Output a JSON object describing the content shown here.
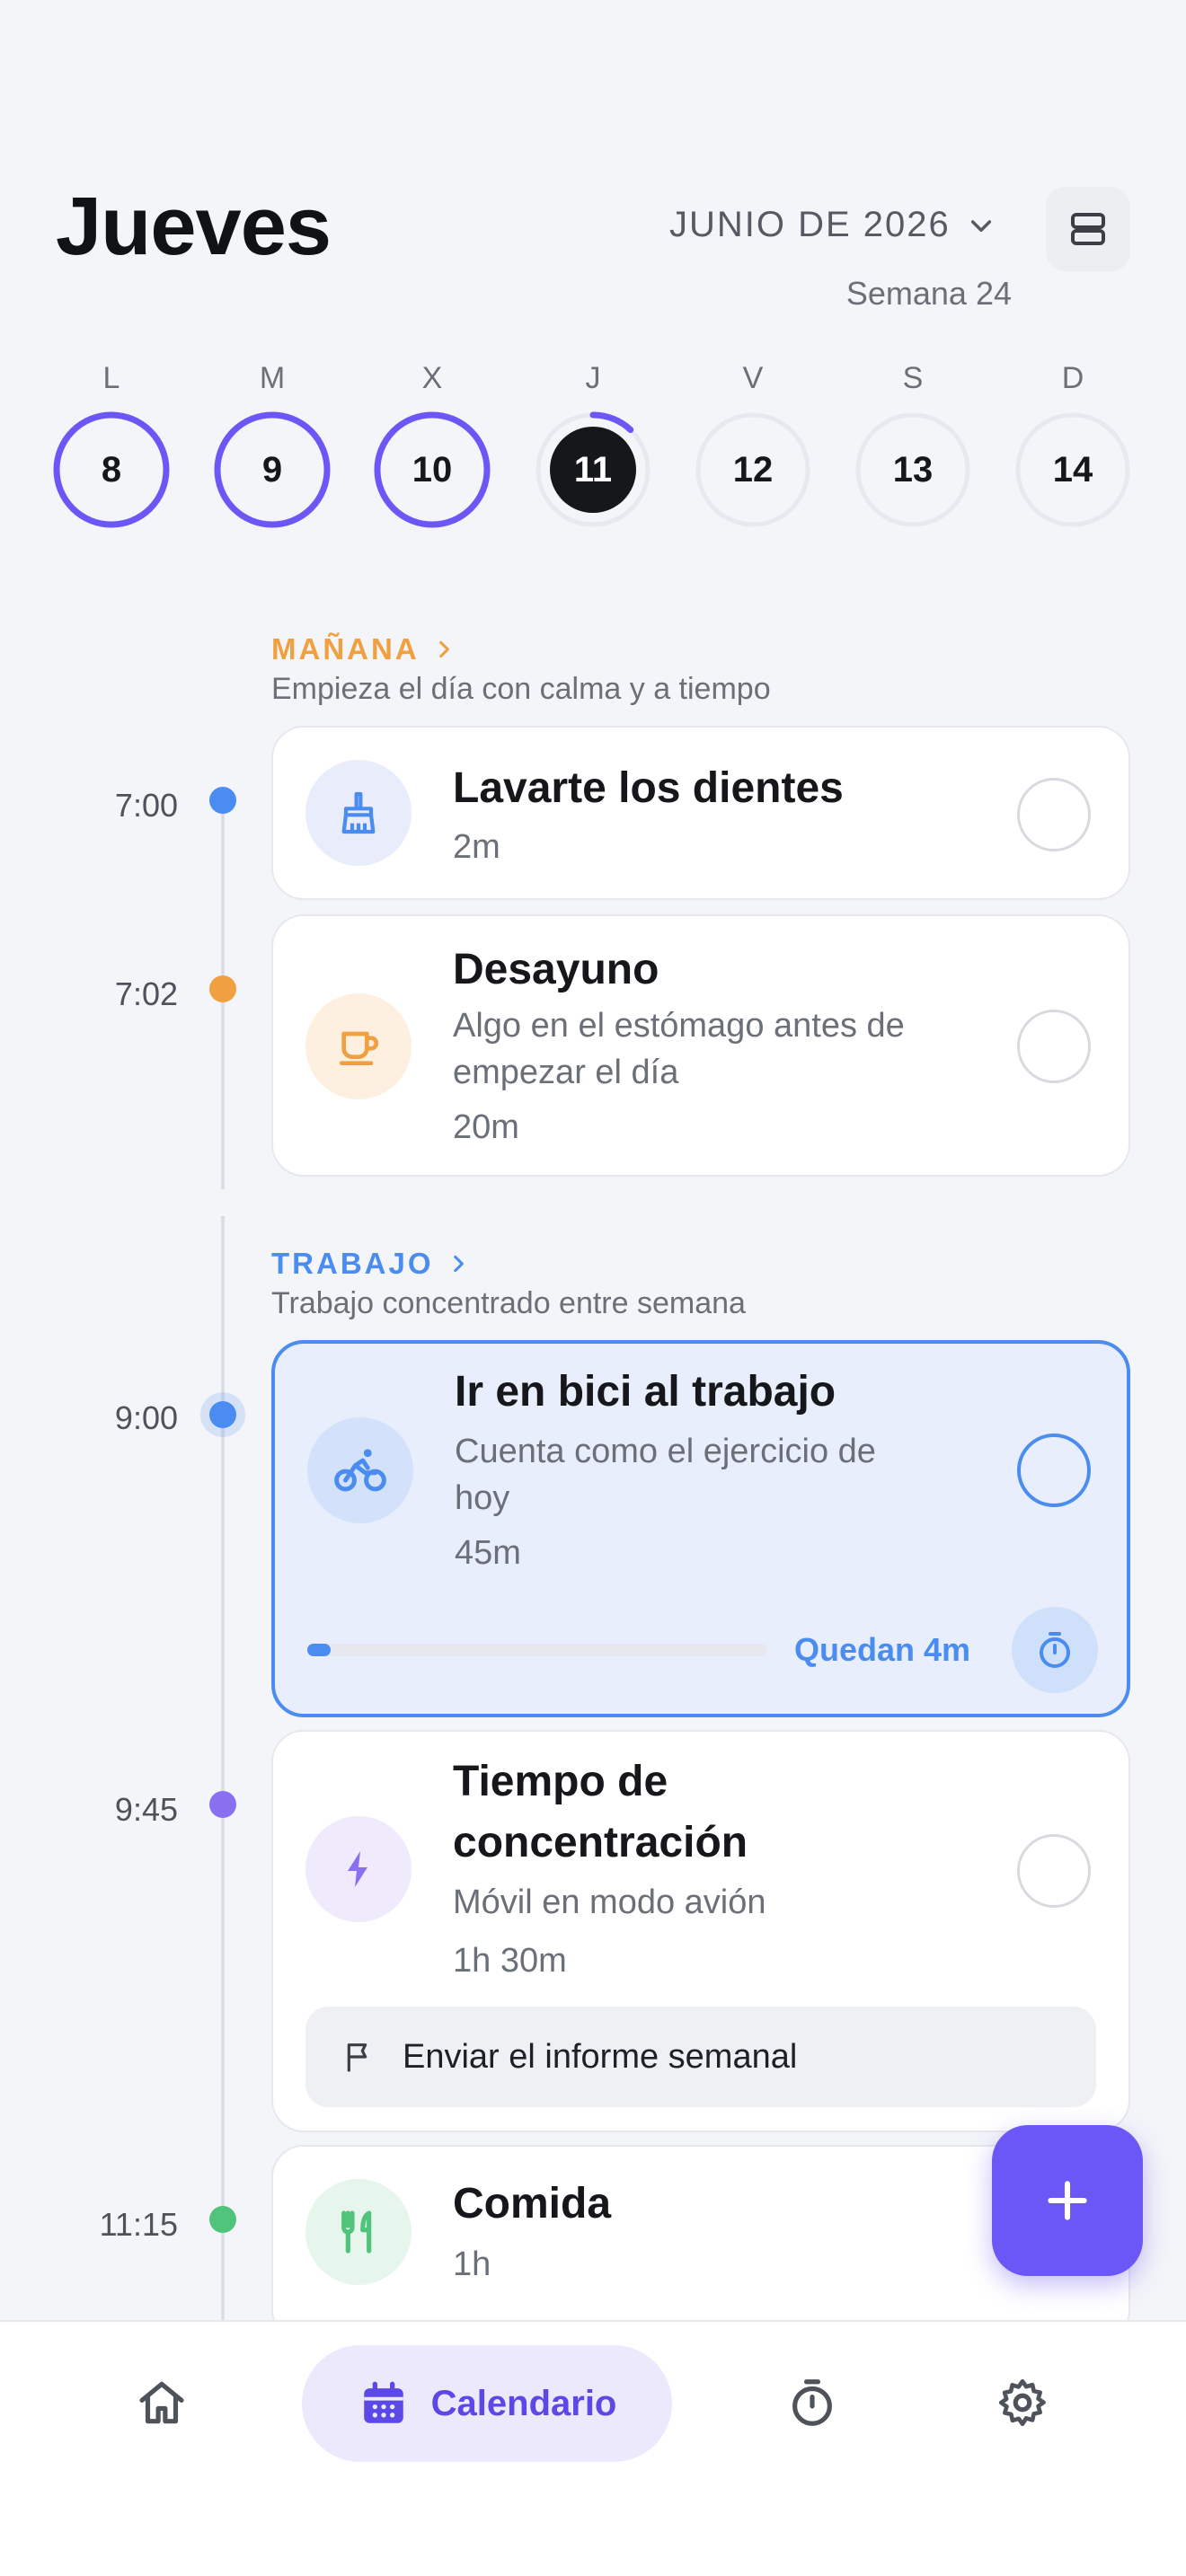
{
  "header": {
    "day_title": "Jueves",
    "month_label": "JUNIO DE 2026",
    "week_label": "Semana 24"
  },
  "week": {
    "days": [
      {
        "letter": "L",
        "num": "8",
        "progress": 1.0
      },
      {
        "letter": "M",
        "num": "9",
        "progress": 1.0
      },
      {
        "letter": "X",
        "num": "10",
        "progress": 1.0
      },
      {
        "letter": "J",
        "num": "11",
        "progress": 0.12,
        "today": true
      },
      {
        "letter": "V",
        "num": "12",
        "progress": 0
      },
      {
        "letter": "S",
        "num": "13",
        "progress": 0
      },
      {
        "letter": "D",
        "num": "14",
        "progress": 0
      }
    ]
  },
  "colors": {
    "accent": "#6b57f5",
    "blue": "#4a8cf0",
    "orange": "#f0a040",
    "purple": "#8a6ff0",
    "green": "#4fc47a"
  },
  "sections": [
    {
      "title": "MAÑANA",
      "subtitle": "Empieza el día con calma y a tiempo",
      "color": "#f0a040"
    },
    {
      "title": "TRABAJO",
      "subtitle": "Trabajo concentrado entre semana",
      "color": "#4a8cf0"
    }
  ],
  "tasks": [
    {
      "time": "7:00",
      "title": "Lavarte los dientes",
      "duration": "2m",
      "icon": "brush-icon"
    },
    {
      "time": "7:02",
      "title": "Desayuno",
      "description_lines": [
        "Algo en el estómago antes de",
        "empezar el día"
      ],
      "duration": "20m",
      "icon": "coffee-cup-icon"
    },
    {
      "time": "9:00",
      "title": "Ir en bici al trabajo",
      "description_lines": [
        "Cuenta como el ejercicio de",
        "hoy"
      ],
      "duration": "45m",
      "icon": "cyclist-icon",
      "remaining": "Quedan 4m",
      "progress": 0.05
    },
    {
      "time": "9:45",
      "title_lines": [
        "Tiempo de",
        "concentración"
      ],
      "description": "Móvil en modo avión",
      "duration": "1h 30m",
      "icon": "lightning-icon",
      "subtask": "Enviar el informe semanal"
    },
    {
      "time": "11:15",
      "title": "Comida",
      "duration": "1h",
      "icon": "utensils-icon"
    }
  ],
  "nav": {
    "calendar_label": "Calendario"
  }
}
